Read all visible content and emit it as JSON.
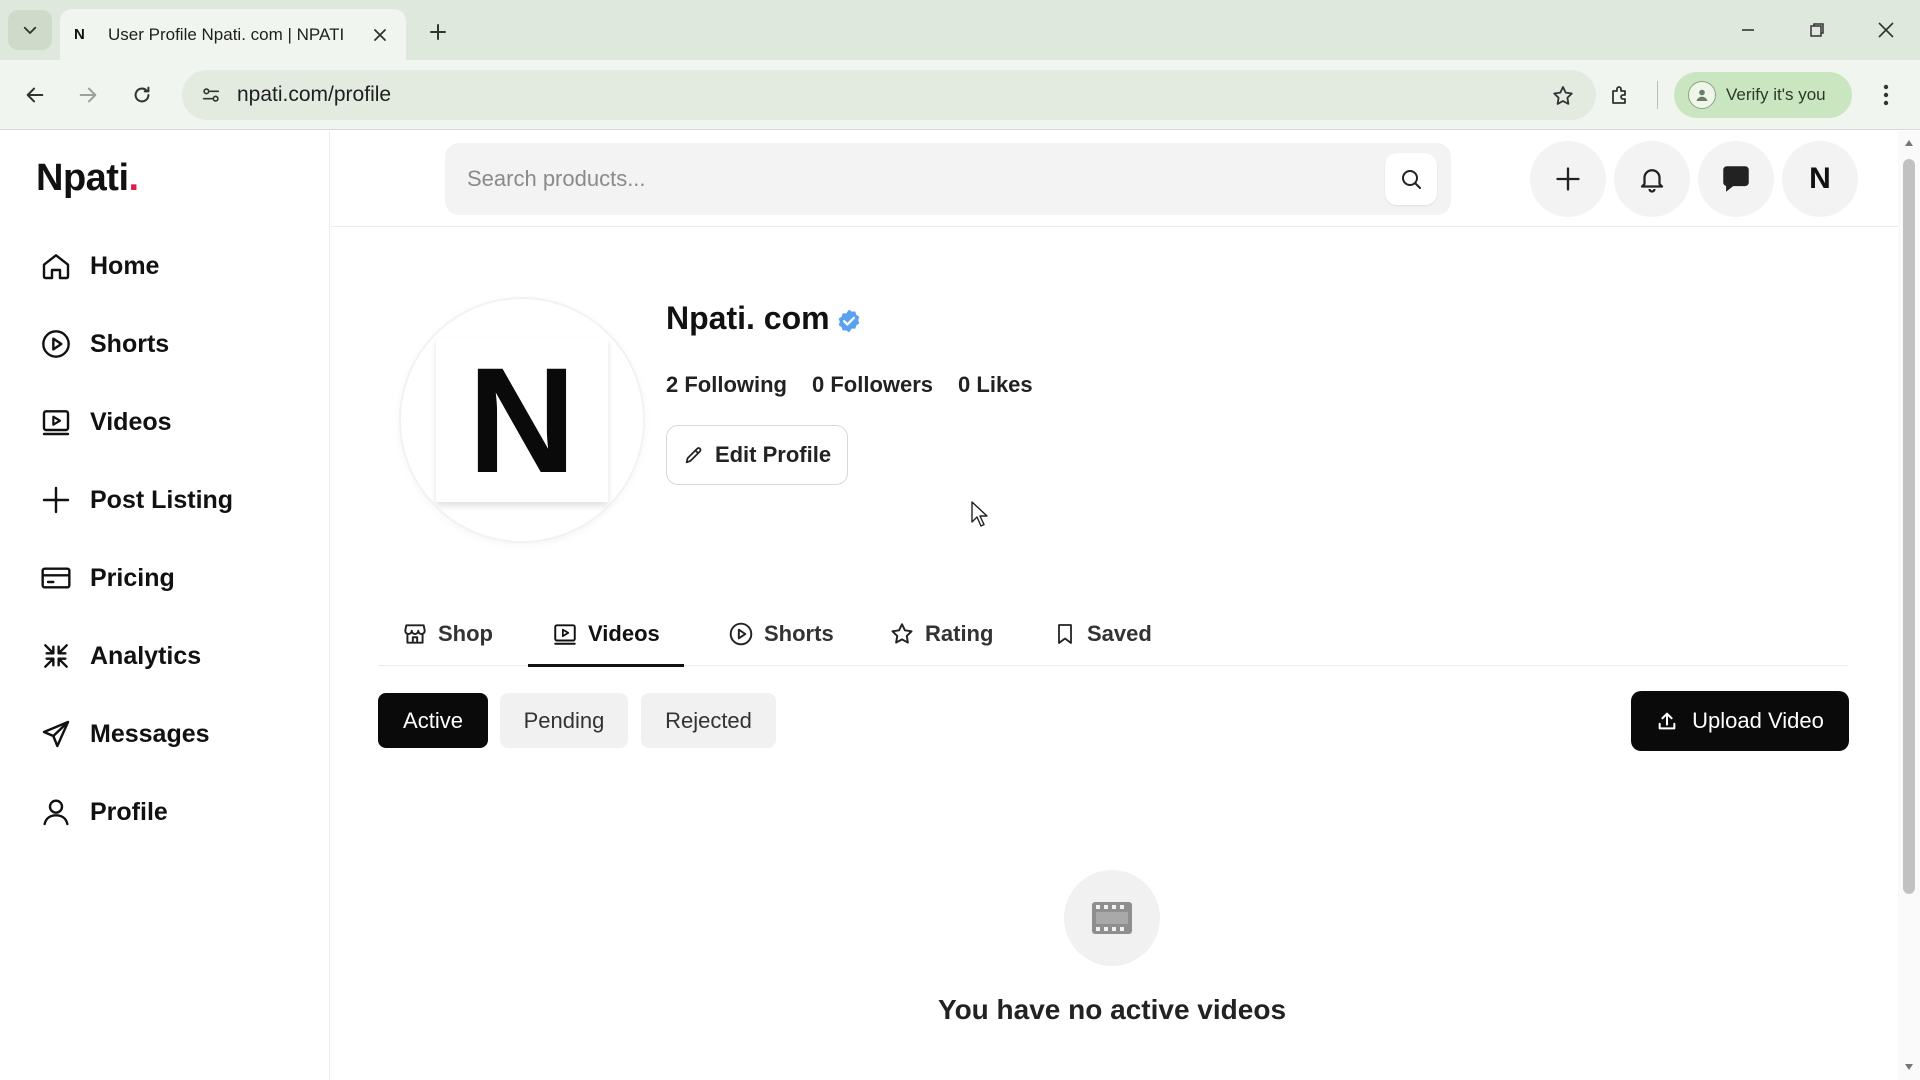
{
  "browser": {
    "tab_title": "User Profile Npati. com | NPATI",
    "tab_favicon": "N",
    "url": "npati.com/profile",
    "verify_label": "Verify it's you",
    "icons": [
      "chevron-down-icon",
      "close-icon",
      "plus-icon",
      "minimize-icon",
      "restore-icon",
      "back-icon",
      "forward-icon",
      "reload-icon",
      "site-info-icon",
      "star-icon",
      "extensions-icon",
      "more-vert-icon"
    ]
  },
  "sidebar": {
    "logo_text": "Npati",
    "logo_dot": ".",
    "items": [
      {
        "label": "Home",
        "icon": "home-icon"
      },
      {
        "label": "Shorts",
        "icon": "play-circle-icon"
      },
      {
        "label": "Videos",
        "icon": "video-icon"
      },
      {
        "label": "Post Listing",
        "icon": "plus-icon"
      },
      {
        "label": "Pricing",
        "icon": "credit-card-icon"
      },
      {
        "label": "Analytics",
        "icon": "analytics-icon"
      },
      {
        "label": "Messages",
        "icon": "send-icon"
      },
      {
        "label": "Profile",
        "icon": "user-icon"
      }
    ]
  },
  "header": {
    "search_placeholder": "Search products...",
    "avatar_letter": "N"
  },
  "profile": {
    "avatar_letter": "N",
    "name": "Npati. com",
    "following": "2 Following",
    "followers": "0 Followers",
    "likes": "0 Likes",
    "edit_label": "Edit Profile"
  },
  "tabs": [
    {
      "label": "Shop",
      "icon": "store-icon"
    },
    {
      "label": "Videos",
      "icon": "video-icon",
      "active": true
    },
    {
      "label": "Shorts",
      "icon": "play-circle-icon"
    },
    {
      "label": "Rating",
      "icon": "star-icon"
    },
    {
      "label": "Saved",
      "icon": "bookmark-icon"
    }
  ],
  "filters": {
    "active": "Active",
    "pending": "Pending",
    "rejected": "Rejected",
    "selected": "Active"
  },
  "upload_label": "Upload Video",
  "empty_state": {
    "text": "You have no active videos",
    "icon": "film-icon"
  },
  "colors": {
    "accent_dot": "#e11d48",
    "verified": "#3b82f6",
    "primary_button": "#0a0a0a",
    "chrome_bg": "#dfe8dc",
    "verify_bg": "#c9e6c1"
  }
}
